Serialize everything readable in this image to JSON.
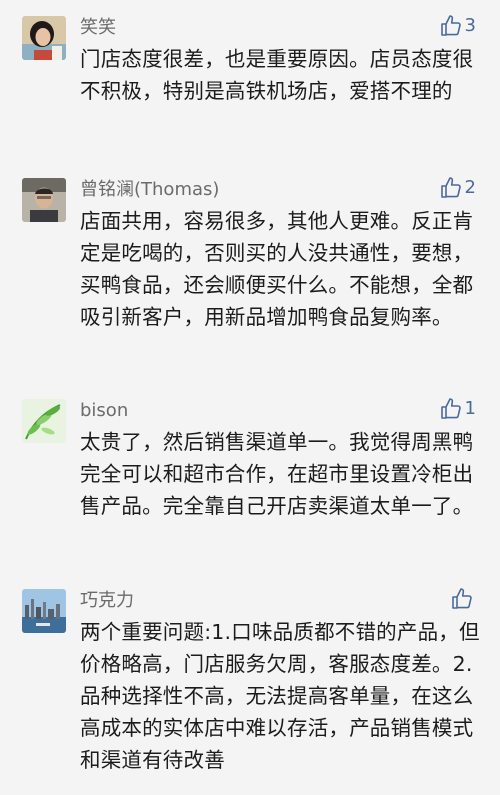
{
  "colors": {
    "background": "#f4f4f4",
    "name": "#6b6b6b",
    "text": "#1c1c1c",
    "like": "#4b6a9c"
  },
  "comments": [
    {
      "name": "笑笑",
      "likes": "3",
      "avatar_icon": "avatar-woman-photo",
      "text": "门店态度很差，也是重要原因。店员态度很不积极，特别是高铁机场店，爱搭不理的"
    },
    {
      "name": "曾铭澜(Thomas)",
      "likes": "2",
      "avatar_icon": "avatar-man-photo",
      "text": "店面共用，容易很多，其他人更难。反正肯定是吃喝的，否则买的人没共通性，要想，买鸭食品，还会顺便买什么。不能想，全都吸引新客户，用新品增加鸭食品复购率。"
    },
    {
      "name": "bison",
      "likes": "1",
      "avatar_icon": "avatar-green-leaves",
      "text": "太贵了，然后销售渠道单一。我觉得周黑鸭完全可以和超市合作，在超市里设置冷柜出售产品。完全靠自己开店卖渠道太单一了。"
    },
    {
      "name": "巧克力",
      "likes": "",
      "avatar_icon": "avatar-city-skyline",
      "text": "两个重要问题:1.口味品质都不错的产品，但价格略高，门店服务欠周，客服态度差。2.品种选择性不高，无法提高客单量，在这么高成本的实体店中难以存活，产品销售模式和渠道有待改善"
    }
  ]
}
